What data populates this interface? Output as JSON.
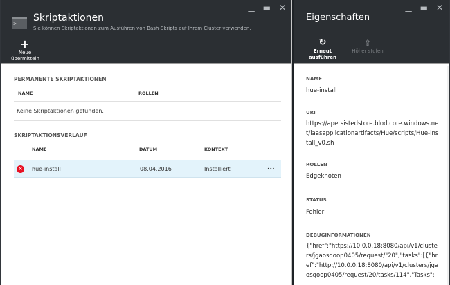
{
  "left": {
    "title": "Skriptaktionen",
    "subtitle": "Sie können Skriptaktionen zum Ausführen von Bash-Skripts auf Ihrem Cluster verwenden.",
    "new_label_1": "Neue",
    "new_label_2": "übermitteln",
    "permanent": {
      "heading": "PERMANENTE SKRIPTAKTIONEN",
      "cols": [
        "NAME",
        "ROLLEN"
      ],
      "empty": "Keine Skriptaktionen gefunden."
    },
    "history": {
      "heading": "SKRIPTAKTIONSVERLAUF",
      "cols": [
        "NAME",
        "DATUM",
        "KONTEXT"
      ],
      "rows": [
        {
          "status": "error",
          "name": "hue-install",
          "date": "08.04.2016",
          "context": "Installiert",
          "more": "•••"
        }
      ]
    }
  },
  "right": {
    "title": "Eigenschaften",
    "rerun": "Erneut ausführen",
    "promote": "Höher stufen",
    "props": [
      {
        "label": "NAME",
        "value": "hue-install"
      },
      {
        "label": "URI",
        "value": "https://apersistedstore.blod.core.windows.net/iaasapplicationartifacts/Hue/scripts/Hue-install_v0.sh"
      },
      {
        "label": "ROLLEN",
        "value": "Edgeknoten"
      },
      {
        "label": "STATUS",
        "value": "Fehler"
      },
      {
        "label": "DEBUGINFORMATIONEN",
        "value": "{\"href\":\"https://10.0.0.18:8080/api/v1/clusters/jgaosqoop0405/request/\"20\",\"tasks\":[{\"href\":\"http://10.0.0.18:8080/api/v1/clusters/jgaosqoop0405/request/20/tasks/114\",\"Tasks\":"
      }
    ]
  },
  "window_controls": {
    "minimize": "▁",
    "maximize": "▬",
    "close": "✕"
  }
}
